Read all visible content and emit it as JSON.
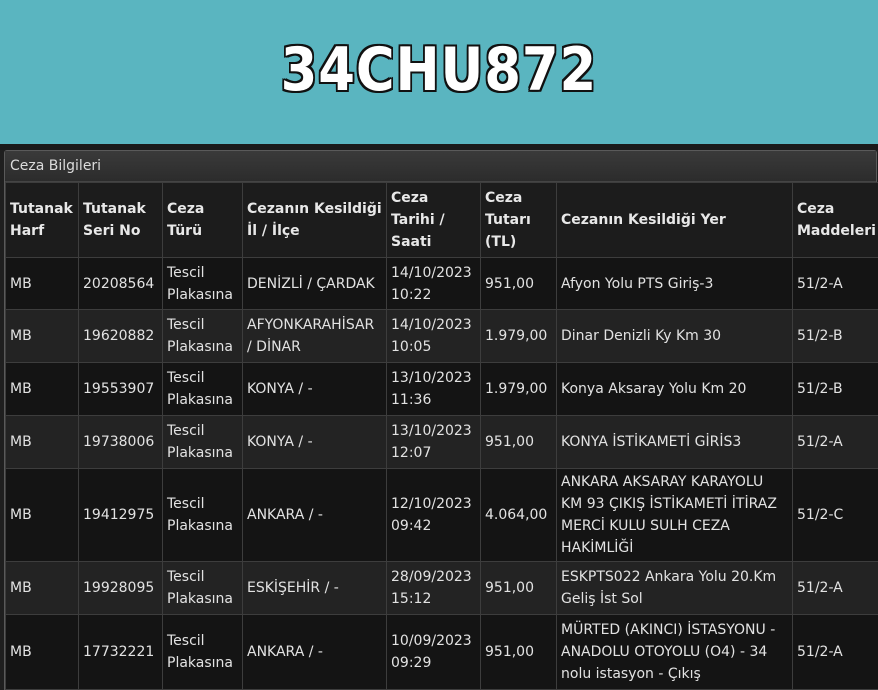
{
  "plate": "34CHU872",
  "panel_title": "Ceza Bilgileri",
  "columns": [
    "Tutanak Harf",
    "Tutanak Seri No",
    "Ceza Türü",
    "Cezanın Kesildiği İl / İlçe",
    "Ceza Tarihi / Saati",
    "Ceza Tutarı (TL)",
    "Cezanın Kesildiği Yer",
    "Ceza Maddeleri"
  ],
  "rows": [
    [
      "MB",
      "20208564",
      "Tescil Plakasına",
      "DENİZLİ / ÇARDAK",
      "14/10/2023 10:22",
      "951,00",
      "Afyon Yolu PTS Giriş-3",
      "51/2-A"
    ],
    [
      "MB",
      "19620882",
      "Tescil Plakasına",
      "AFYONKARAHİSAR / DİNAR",
      "14/10/2023 10:05",
      "1.979,00",
      "Dinar Denizli Ky Km 30",
      "51/2-B"
    ],
    [
      "MB",
      "19553907",
      "Tescil Plakasına",
      "KONYA / -",
      "13/10/2023 11:36",
      "1.979,00",
      "Konya Aksaray Yolu Km 20",
      "51/2-B"
    ],
    [
      "MB",
      "19738006",
      "Tescil Plakasına",
      "KONYA / -",
      "13/10/2023 12:07",
      "951,00",
      "KONYA İSTİKAMETİ GİRİS3",
      "51/2-A"
    ],
    [
      "MB",
      "19412975",
      "Tescil Plakasına",
      "ANKARA / -",
      "12/10/2023 09:42",
      "4.064,00",
      "ANKARA AKSARAY KARAYOLU KM 93 ÇIKIŞ İSTİKAMETİ İTİRAZ MERCİ KULU SULH CEZA HAKİMLİĞİ",
      "51/2-C"
    ],
    [
      "MB",
      "19928095",
      "Tescil Plakasına",
      "ESKİŞEHİR / -",
      "28/09/2023 15:12",
      "951,00",
      "ESKPTS022 Ankara Yolu 20.Km Geliş İst Sol",
      "51/2-A"
    ],
    [
      "MB",
      "17732221",
      "Tescil Plakasına",
      "ANKARA / -",
      "10/09/2023 09:29",
      "951,00",
      "MÜRTED (AKINCI) İSTASYONU - ANADOLU OTOYOLU (O4) - 34 nolu istasyon - Çıkış",
      "51/2-A"
    ]
  ]
}
